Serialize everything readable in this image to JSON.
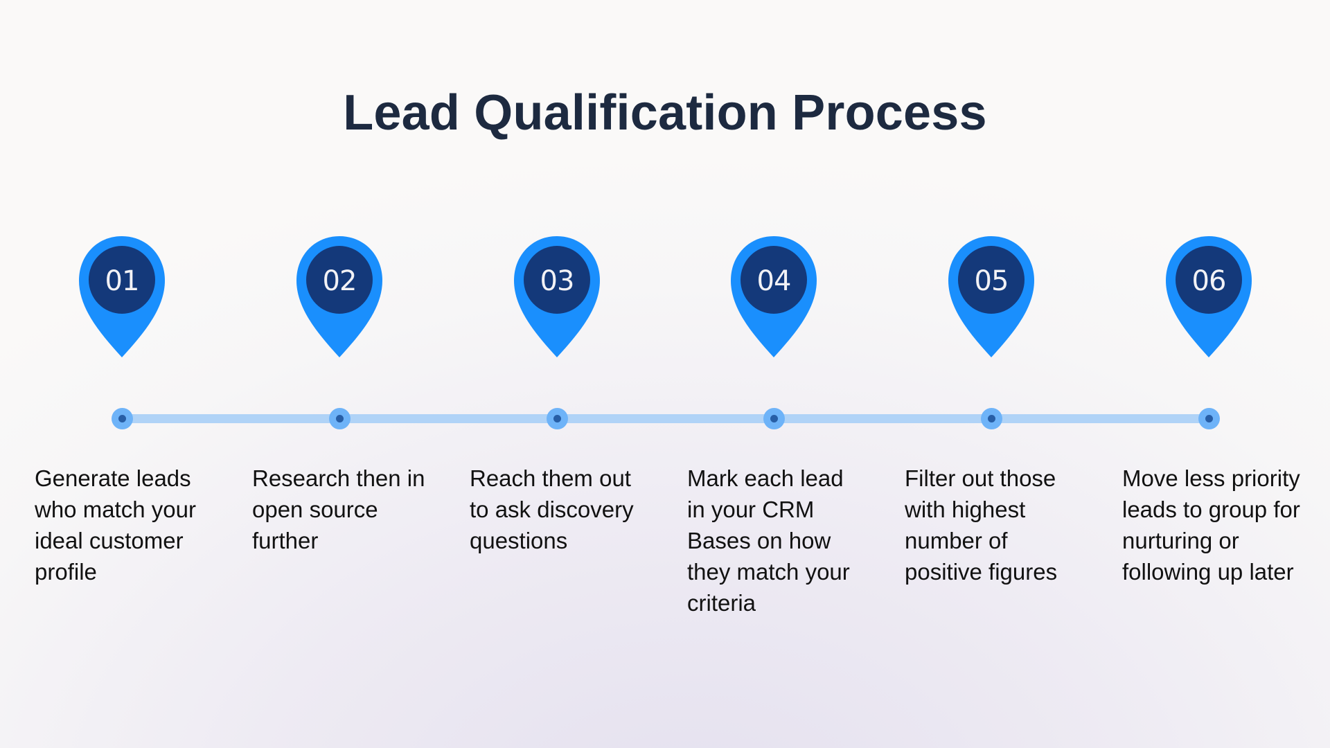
{
  "title": "Lead Qualification Process",
  "colors": {
    "pin_outer": "#1a8ffd",
    "pin_inner": "#14397a",
    "timeline": "#b0d3f7",
    "node_ring": "#6eb3f8",
    "node_dot": "#275ea6",
    "title": "#1d2a40"
  },
  "steps": [
    {
      "number": "01",
      "text": "Generate leads who match your ideal customer profile"
    },
    {
      "number": "02",
      "text": "Research then in open source further"
    },
    {
      "number": "03",
      "text": "Reach them out to ask discovery questions"
    },
    {
      "number": "04",
      "text": "Mark each lead in your CRM Bases on how they match your criteria"
    },
    {
      "number": "05",
      "text": "Filter out those with highest number of positive figures"
    },
    {
      "number": "06",
      "text": "Move less priority leads to group for nurturing or following up later"
    }
  ]
}
